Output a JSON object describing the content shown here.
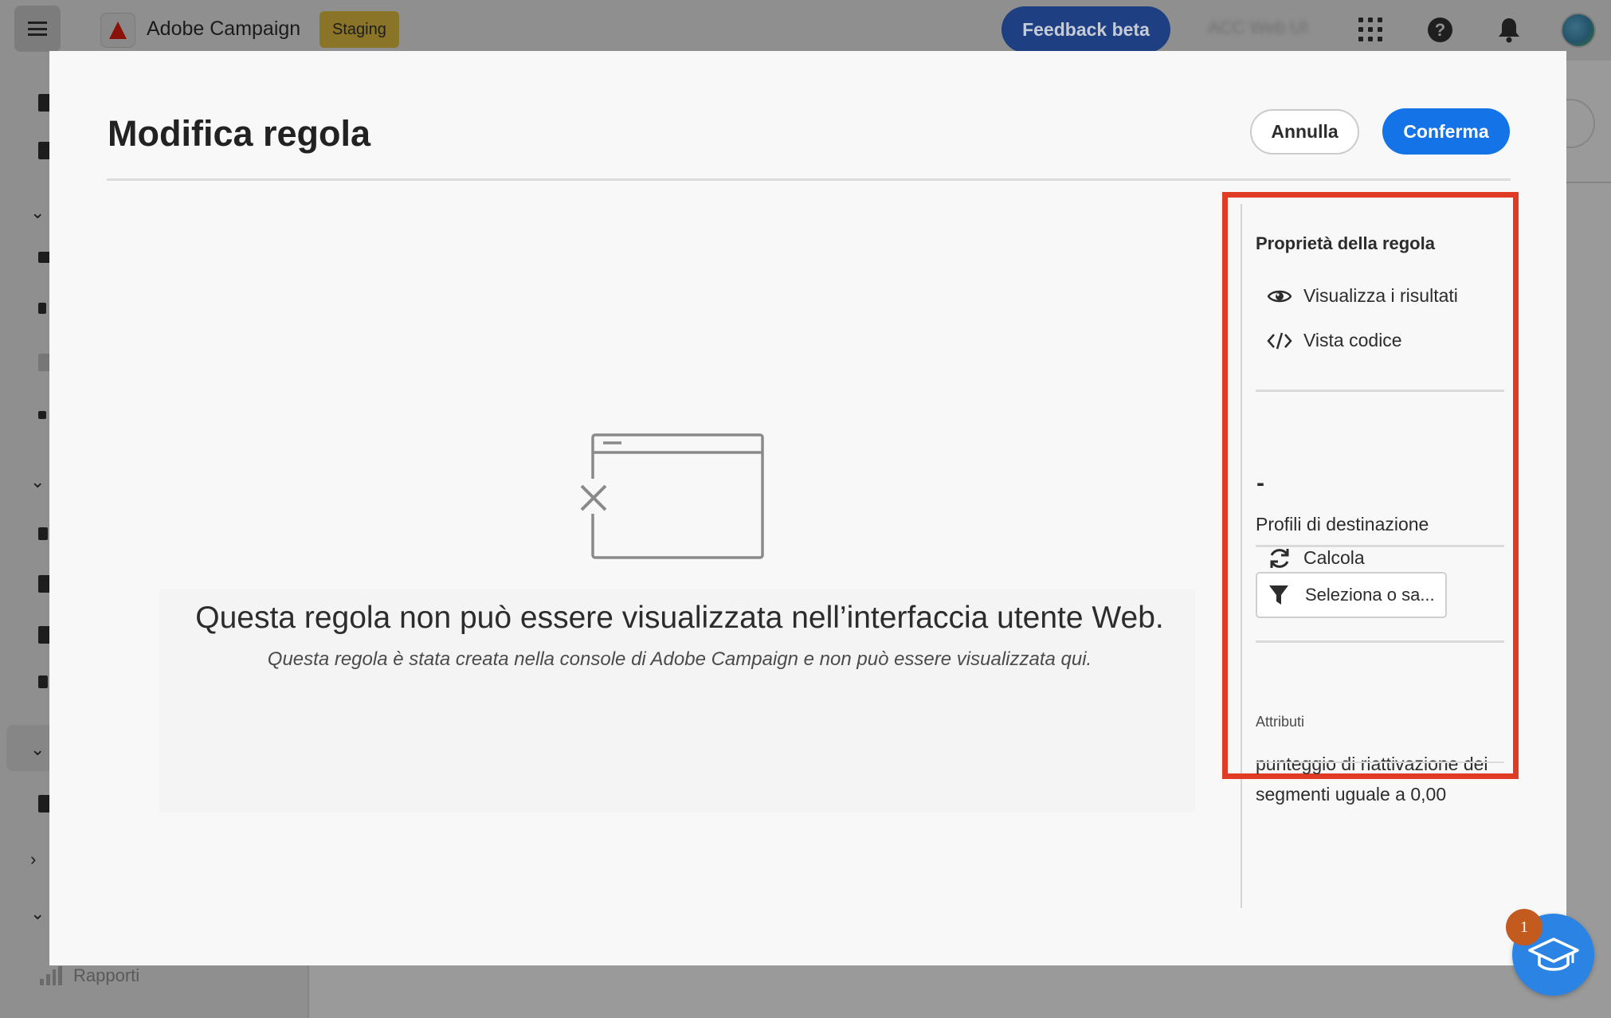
{
  "app": {
    "brand_name": "Adobe Campaign",
    "environment_badge": "Staging",
    "feedback_label": "Feedback beta",
    "org_name": "ACC Web UI"
  },
  "sidebar": {
    "reports_label": "Rapporti"
  },
  "modal": {
    "title": "Modifica regola",
    "cancel_label": "Annulla",
    "confirm_label": "Conferma",
    "empty_title": "Questa regola non può essere visualizzata nell’interfaccia utente Web.",
    "empty_subtitle": "Questa regola è stata creata nella console di Adobe Campaign e non può essere visualizzata qui."
  },
  "properties_panel": {
    "title": "Proprietà della regola",
    "view_results_label": "Visualizza i risultati",
    "code_view_label": "Vista codice",
    "count_value": "-",
    "target_profiles_label": "Profili di destinazione",
    "calculate_label": "Calcola",
    "select_or_save_label": "Seleziona o sa...",
    "attributes_label": "Attributi",
    "attributes_value": "punteggio di riattivazione dei segmenti uguale a 0,00"
  },
  "help_fab": {
    "badge_count": "1"
  },
  "colors": {
    "primary_button": "#1473e6",
    "highlight_border": "#e03b24",
    "fab": "#2b83e4",
    "fab_badge": "#c35b1f"
  }
}
